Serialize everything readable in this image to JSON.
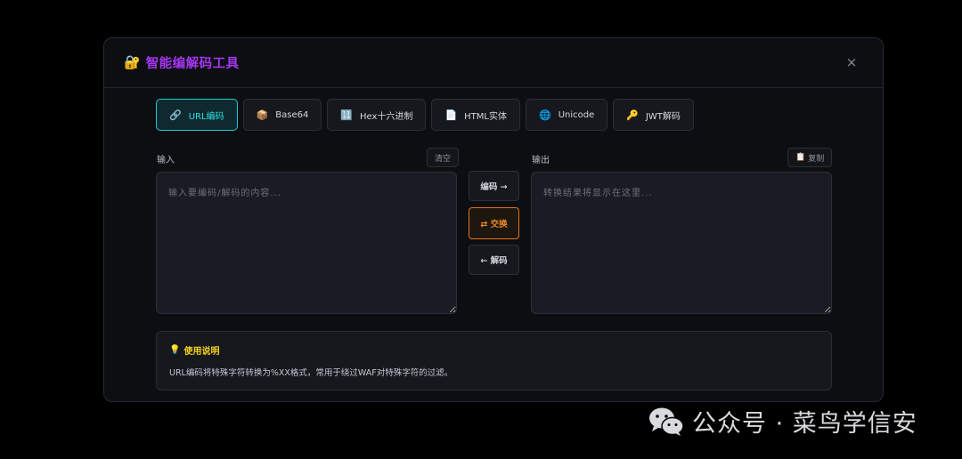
{
  "modal": {
    "title_icon": "🔐",
    "title": "智能编解码工具",
    "close": "×"
  },
  "tabs": [
    {
      "icon": "🔗",
      "label": "URL编码",
      "active": true
    },
    {
      "icon": "📦",
      "label": "Base64",
      "active": false
    },
    {
      "icon": "🔢",
      "label": "Hex十六进制",
      "active": false
    },
    {
      "icon": "📄",
      "label": "HTML实体",
      "active": false
    },
    {
      "icon": "🌐",
      "label": "Unicode",
      "active": false
    },
    {
      "icon": "🔑",
      "label": "JWT解码",
      "active": false
    }
  ],
  "input": {
    "label": "输入",
    "clear_label": "清空",
    "placeholder": "输入要编码/解码的内容..."
  },
  "output": {
    "label": "输出",
    "copy_icon": "📋",
    "copy_label": "复制",
    "placeholder": "转换结果将显示在这里..."
  },
  "actions": {
    "encode": "编码 →",
    "swap": "⇄ 交换",
    "decode": "← 解码"
  },
  "info": {
    "icon": "💡",
    "title": "使用说明",
    "text": "URL编码将特殊字符转换为%XX格式，常用于绕过WAF对特殊字符的过滤。"
  },
  "watermark": {
    "text": "公众号 · 菜鸟学信安"
  },
  "colors": {
    "accent_purple": "#a437f0",
    "accent_cyan": "#1fc8d2",
    "accent_orange": "#e0731b",
    "info_yellow": "#f2d21c"
  }
}
